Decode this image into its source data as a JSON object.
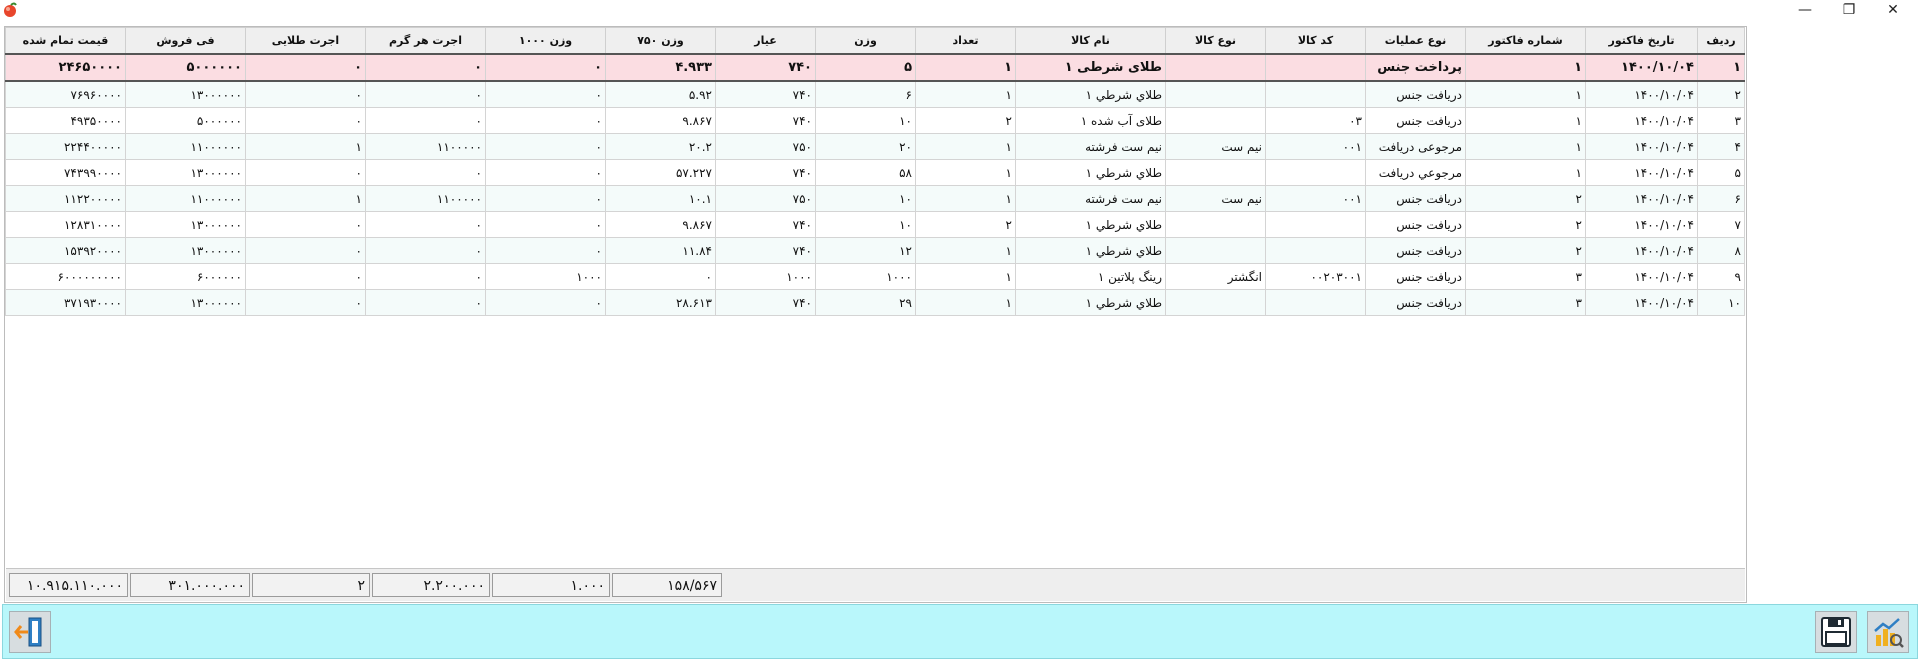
{
  "window": {
    "minimize_symbol": "—",
    "restore_symbol": "❐",
    "close_symbol": "✕"
  },
  "table": {
    "columns": [
      "ردیف",
      "تاریخ فاکتور",
      "شماره فاکتور",
      "نوع عملیات",
      "کد کالا",
      "نوع کالا",
      "نام کالا",
      "تعداد",
      "وزن",
      "عیار",
      "وزن ۷۵۰",
      "وزن ۱۰۰۰",
      "اجرت هر گرم",
      "اجرت طلایی",
      "فی فروش",
      "قیمت تمام شده"
    ],
    "rows": [
      [
        "۱",
        "۱۴۰۰/۱۰/۰۴",
        "۱",
        "پرداخت جنس",
        "",
        "",
        "طلای شرطی ۱",
        "۱",
        "۵",
        "۷۴۰",
        "۴.۹۳۳",
        "۰",
        "۰",
        "۰",
        "۵۰۰۰۰۰۰",
        "۲۴۶۵۰۰۰۰"
      ],
      [
        "۲",
        "۱۴۰۰/۱۰/۰۴",
        "۱",
        "دریافت جنس",
        "",
        "",
        "طلاي شرطي ۱",
        "۱",
        "۶",
        "۷۴۰",
        "۵.۹۲",
        "۰",
        "۰",
        "۰",
        "۱۳۰۰۰۰۰۰",
        "۷۶۹۶۰۰۰۰"
      ],
      [
        "۳",
        "۱۴۰۰/۱۰/۰۴",
        "۱",
        "دریافت جنس",
        "۰۳",
        "",
        "طلای آب شده ۱",
        "۲",
        "۱۰",
        "۷۴۰",
        "۹.۸۶۷",
        "۰",
        "۰",
        "۰",
        "۵۰۰۰۰۰۰",
        "۴۹۳۵۰۰۰۰"
      ],
      [
        "۴",
        "۱۴۰۰/۱۰/۰۴",
        "۱",
        "مرجوعی دریافت",
        "۰۰۱",
        "نیم ست",
        "نیم ست فرشته",
        "۱",
        "۲۰",
        "۷۵۰",
        "۲۰.۲",
        "۰",
        "۱۱۰۰۰۰۰",
        "۱",
        "۱۱۰۰۰۰۰۰",
        "۲۲۴۴۰۰۰۰۰"
      ],
      [
        "۵",
        "۱۴۰۰/۱۰/۰۴",
        "۱",
        "مرجوعي دریافت",
        "",
        "",
        "طلاي شرطي ۱",
        "۱",
        "۵۸",
        "۷۴۰",
        "۵۷.۲۲۷",
        "۰",
        "۰",
        "۰",
        "۱۳۰۰۰۰۰۰",
        "۷۴۳۹۹۰۰۰۰"
      ],
      [
        "۶",
        "۱۴۰۰/۱۰/۰۴",
        "۲",
        "دریافت جنس",
        "۰۰۱",
        "نیم ست",
        "نیم ست فرشته",
        "۱",
        "۱۰",
        "۷۵۰",
        "۱۰.۱",
        "۰",
        "۱۱۰۰۰۰۰",
        "۱",
        "۱۱۰۰۰۰۰۰",
        "۱۱۲۲۰۰۰۰۰"
      ],
      [
        "۷",
        "۱۴۰۰/۱۰/۰۴",
        "۲",
        "دریافت جنس",
        "",
        "",
        "طلاي شرطي ۱",
        "۲",
        "۱۰",
        "۷۴۰",
        "۹.۸۶۷",
        "۰",
        "۰",
        "۰",
        "۱۳۰۰۰۰۰۰",
        "۱۲۸۳۱۰۰۰۰"
      ],
      [
        "۸",
        "۱۴۰۰/۱۰/۰۴",
        "۲",
        "دریافت جنس",
        "",
        "",
        "طلاي شرطي ۱",
        "۱",
        "۱۲",
        "۷۴۰",
        "۱۱.۸۴",
        "۰",
        "۰",
        "۰",
        "۱۳۰۰۰۰۰۰",
        "۱۵۳۹۲۰۰۰۰"
      ],
      [
        "۹",
        "۱۴۰۰/۱۰/۰۴",
        "۳",
        "دریافت جنس",
        "۰۰۲۰۳۰۰۱",
        "انگشتر",
        "رینگ پلاتین ۱",
        "۱",
        "۱۰۰۰",
        "۱۰۰۰",
        "۰",
        "۱۰۰۰",
        "۰",
        "۰",
        "۶۰۰۰۰۰۰",
        "۶۰۰۰۰۰۰۰۰۰"
      ],
      [
        "۱۰",
        "۱۴۰۰/۱۰/۰۴",
        "۳",
        "دریافت جنس",
        "",
        "",
        "طلاي شرطي ۱",
        "۱",
        "۲۹",
        "۷۴۰",
        "۲۸.۶۱۳",
        "۰",
        "۰",
        "۰",
        "۱۳۰۰۰۰۰۰",
        "۳۷۱۹۳۰۰۰۰"
      ]
    ]
  },
  "totals": {
    "weight_750": "۱۵۸/۵۶۷",
    "weight_1000": "۱.۰۰۰",
    "wage_per_gram": "۲.۲۰۰.۰۰۰",
    "gold_wage": "۲",
    "sale_price": "۳۰۱.۰۰۰.۰۰۰",
    "final_price": "۱۰.۹۱۵.۱۱۰.۰۰۰"
  },
  "icons": {
    "app": "app-logo-icon",
    "exit": "exit-door-icon",
    "save": "floppy-disk-icon",
    "report": "chart-report-icon"
  },
  "colors": {
    "selected_row": "#fbdde2",
    "alt_row": "#f4fbfa",
    "bottom_bar": "#b9f7fb"
  }
}
